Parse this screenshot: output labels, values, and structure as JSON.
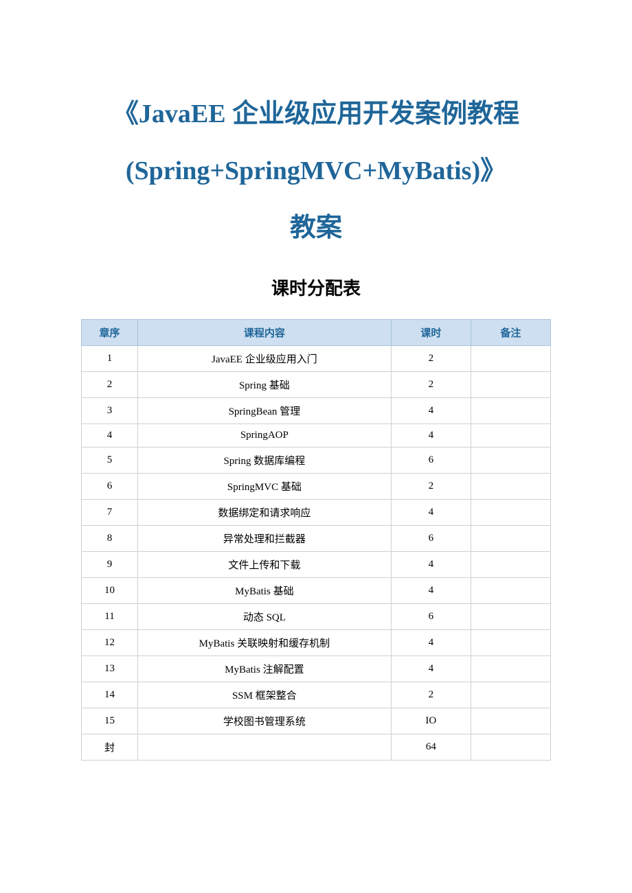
{
  "title": {
    "line1": "《JavaEE 企业级应用开发案例教程",
    "line2": "(Spring+SpringMVC+MyBatis)》",
    "line3": "教案"
  },
  "subtitle": "课时分配表",
  "table": {
    "headers": {
      "col1": "章序",
      "col2": "课程内容",
      "col3": "课时",
      "col4": "备注"
    },
    "rows": [
      {
        "chapter": "1",
        "content": "JavaEE 企业级应用入门",
        "hours": "2",
        "note": ""
      },
      {
        "chapter": "2",
        "content": "Spring 基础",
        "hours": "2",
        "note": ""
      },
      {
        "chapter": "3",
        "content": "SpringBean 管理",
        "hours": "4",
        "note": ""
      },
      {
        "chapter": "4",
        "content": "SpringAOP",
        "hours": "4",
        "note": ""
      },
      {
        "chapter": "5",
        "content": "Spring 数据库编程",
        "hours": "6",
        "note": ""
      },
      {
        "chapter": "6",
        "content": "SpringMVC 基础",
        "hours": "2",
        "note": ""
      },
      {
        "chapter": "7",
        "content": "数据绑定和请求响应",
        "hours": "4",
        "note": ""
      },
      {
        "chapter": "8",
        "content": "异常处理和拦截器",
        "hours": "6",
        "note": ""
      },
      {
        "chapter": "9",
        "content": "文件上传和下载",
        "hours": "4",
        "note": ""
      },
      {
        "chapter": "10",
        "content": "MyBatis 基础",
        "hours": "4",
        "note": ""
      },
      {
        "chapter": "11",
        "content": "动态 SQL",
        "hours": "6",
        "note": ""
      },
      {
        "chapter": "12",
        "content": "MyBatis 关联映射和缓存机制",
        "hours": "4",
        "note": ""
      },
      {
        "chapter": "13",
        "content": "MyBatis 注解配置",
        "hours": "4",
        "note": ""
      },
      {
        "chapter": "14",
        "content": "SSM 框架整合",
        "hours": "2",
        "note": ""
      },
      {
        "chapter": "15",
        "content": "学校图书管理系统",
        "hours": "IO",
        "note": ""
      },
      {
        "chapter": "封",
        "content": "",
        "hours": "64",
        "note": ""
      }
    ]
  }
}
